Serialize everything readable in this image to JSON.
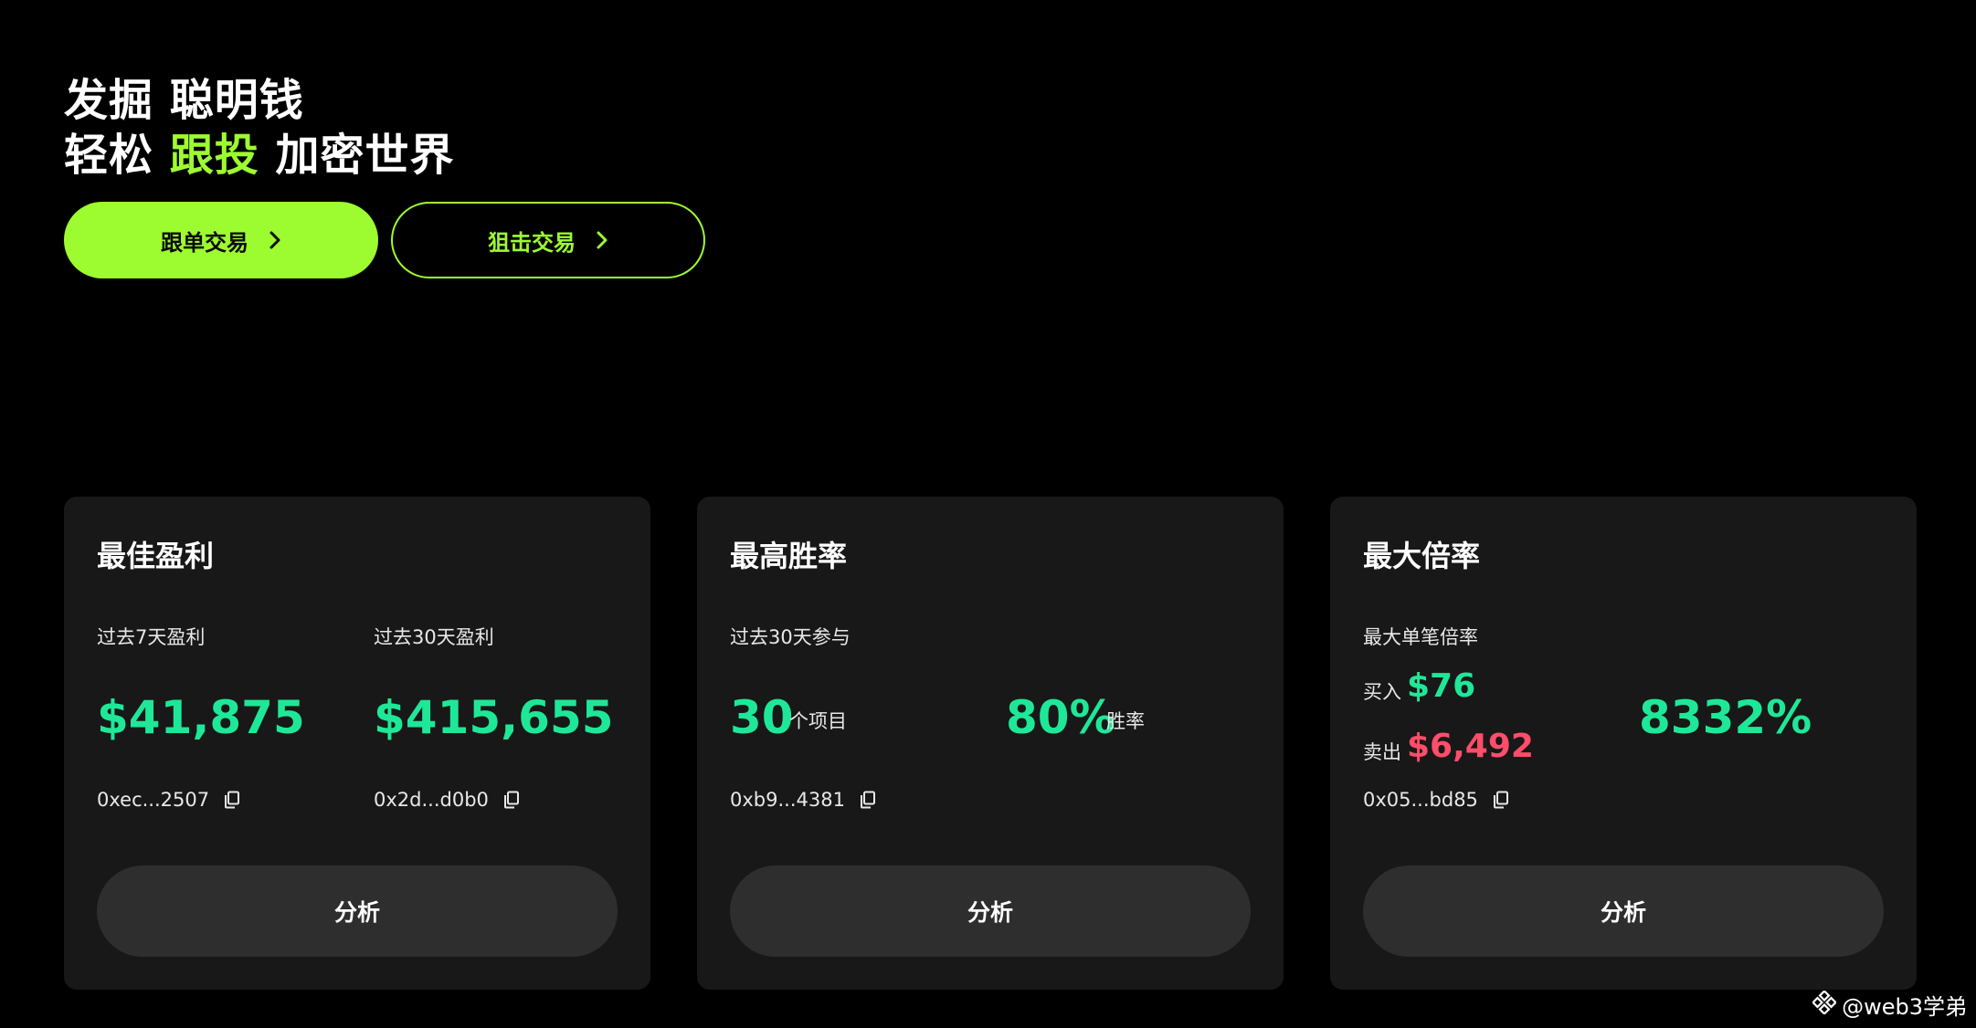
{
  "hero": {
    "line1": "发掘 聪明钱",
    "line2_a": "轻松 ",
    "line2_accent": "跟投",
    "line2_b": " 加密世界"
  },
  "buttons": {
    "copy_trade": "跟单交易",
    "snipe_trade": "狙击交易"
  },
  "cards": {
    "best_profit": {
      "title": "最佳盈利",
      "label_7d": "过去7天盈利",
      "label_30d": "过去30天盈利",
      "value_7d": "$41,875",
      "value_30d": "$415,655",
      "addr_7d": "0xec...2507",
      "addr_30d": "0x2d...d0b0",
      "action": "分析"
    },
    "highest_winrate": {
      "title": "最高胜率",
      "label": "过去30天参与",
      "projects": "30",
      "projects_unit": "个项目",
      "winrate": "80%",
      "winrate_unit": "胜率",
      "addr": "0xb9...4381",
      "action": "分析"
    },
    "max_multiple": {
      "title": "最大倍率",
      "label": "最大单笔倍率",
      "buy_label": "买入",
      "buy_value": "$76",
      "sell_label": "卖出",
      "sell_value": "$6,492",
      "multiple": "8332%",
      "addr": "0x05...bd85",
      "action": "分析"
    }
  },
  "watermark": "@web3学弟",
  "colors": {
    "accent_green": "#9dfc2f",
    "value_green": "#1ee898",
    "value_red": "#ff4d6a",
    "card_bg": "#181818",
    "button_bg": "#2e2e2e"
  }
}
